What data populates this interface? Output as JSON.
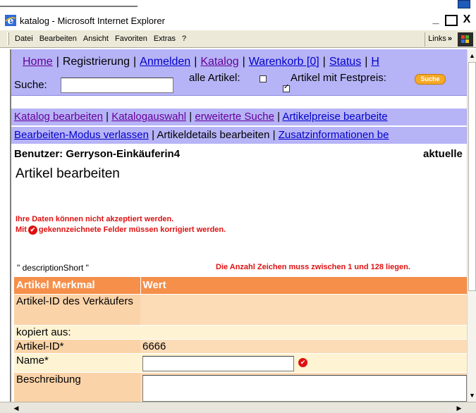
{
  "window": {
    "title": "katalog - Microsoft Internet Explorer",
    "minimize": "_",
    "close": "X"
  },
  "menubar": {
    "items": [
      "Datei",
      "Bearbeiten",
      "Ansicht",
      "Favoriten",
      "Extras",
      "?"
    ],
    "links": "Links",
    "links_chevron": "»"
  },
  "nav": {
    "home": "Home",
    "register": "Registrierung",
    "login": "Anmelden",
    "catalog": "Katalog",
    "cart": "Warenkorb [0]",
    "status": "Status",
    "overflow": "H",
    "separator": "|"
  },
  "search": {
    "label": "Suche:",
    "value": "",
    "all_articles": "alle Artikel:",
    "all_checked": false,
    "fixed_price": "Artikel mit Festpreis:",
    "fixed_checked": true,
    "button": "Suche"
  },
  "nav2": {
    "edit_catalog": "Katalog bearbeiten",
    "catalog_select": "Katalogauswahl",
    "advanced_search": "erweiterte Suche",
    "edit_prices": "Artikelpreise bearbeite",
    "separator": "|"
  },
  "nav3": {
    "leave_edit": "Bearbeiten-Modus verlassen",
    "edit_details": "Artikeldetails bearbeiten",
    "extra_info": "Zusatzinformationen be",
    "separator": "|"
  },
  "user": {
    "label": "Benutzer: Gerryson-Einkäuferin4",
    "right": "aktuelle"
  },
  "page": {
    "title": "Artikel bearbeiten"
  },
  "errors": {
    "line1": "Ihre Daten können nicht akzeptiert werden.",
    "line2_pre": "Mit",
    "line2_post": "gekennzeichnete Felder müssen korrigiert werden.",
    "field_name": "\" descriptionShort \"",
    "field_msg": "Die Anzahl Zeichen muss zwischen 1 und 128 liegen."
  },
  "table": {
    "headers": [
      "Artikel Merkmal",
      "Wert"
    ],
    "rows": [
      {
        "label": "Artikel-ID des Verkäufers",
        "value": ""
      },
      {
        "label": "kopiert aus:",
        "value": ""
      },
      {
        "label": "Artikel-ID*",
        "value": "6666"
      },
      {
        "label": "Name*",
        "value": ""
      },
      {
        "label": "Beschreibung",
        "value": ""
      }
    ]
  },
  "colors": {
    "nav_bg": "#b6b3f7",
    "table_header": "#f58f4a",
    "error": "#e01010",
    "button_orange": "#f7a928"
  },
  "icons": [
    "ie-icon",
    "windows-logo-icon",
    "error-icon",
    "scroll-up-icon",
    "scroll-down-icon",
    "scroll-left-icon",
    "scroll-right-icon"
  ]
}
